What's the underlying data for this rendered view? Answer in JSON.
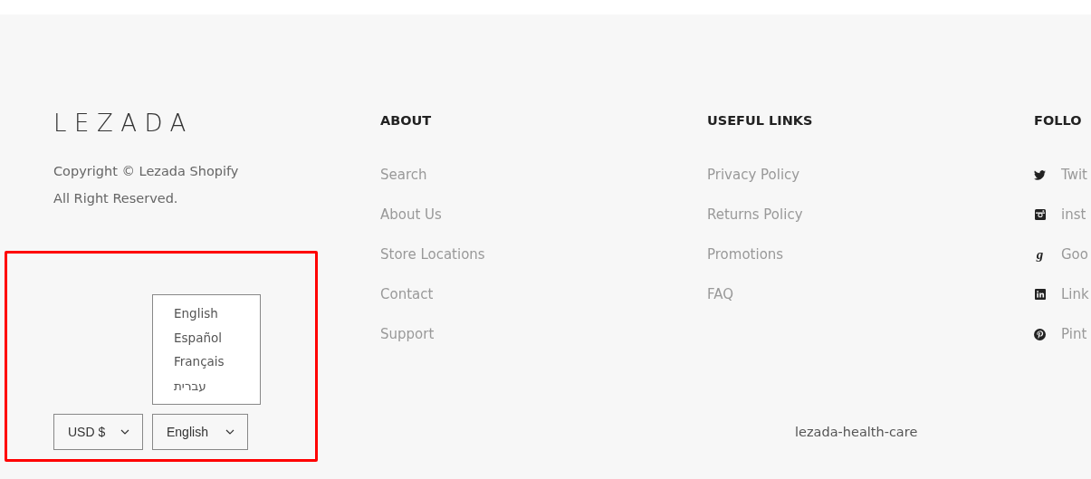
{
  "brand": {
    "logo": "LEZADA",
    "copyright_lines": [
      "Copyright © Lezada Shopify",
      "All Right Reserved."
    ]
  },
  "columns": [
    {
      "heading": "ABOUT",
      "links": [
        {
          "label": "Search"
        },
        {
          "label": "About Us"
        },
        {
          "label": "Store Locations"
        },
        {
          "label": "Contact"
        },
        {
          "label": "Support"
        }
      ]
    },
    {
      "heading": "USEFUL LINKS",
      "links": [
        {
          "label": "Privacy Policy"
        },
        {
          "label": "Returns Policy"
        },
        {
          "label": "Promotions"
        },
        {
          "label": "FAQ"
        }
      ]
    },
    {
      "heading": "FOLLO",
      "links": [
        {
          "label": "Twit",
          "kind": "twitter"
        },
        {
          "label": "inst",
          "kind": "instagram"
        },
        {
          "label": "Goo",
          "kind": "google",
          "glyph": "g"
        },
        {
          "label": "Link",
          "kind": "linkedin"
        },
        {
          "label": "Pint",
          "kind": "pinterest"
        }
      ]
    }
  ],
  "currency_select": {
    "value": "USD $"
  },
  "language_select": {
    "value": "English",
    "expanded": true,
    "options": [
      "English",
      "Español",
      "Français",
      "עברית"
    ]
  },
  "store_name": "lezada-health-care",
  "annotation": {
    "kind": "frame",
    "color": "#ff0000"
  }
}
